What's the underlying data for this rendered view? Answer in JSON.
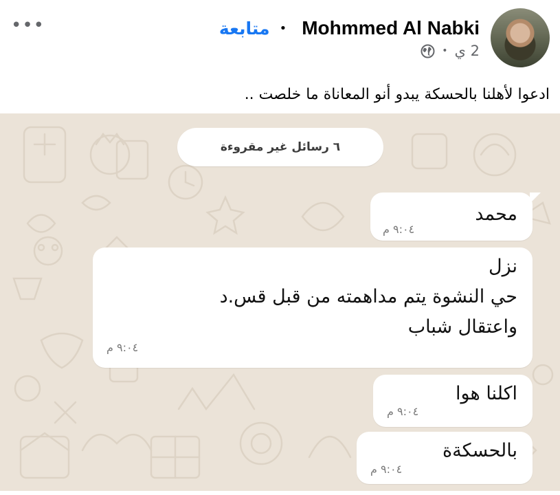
{
  "post": {
    "author_name": "Mohmmed Al Nabki",
    "follow_label": "متابعة",
    "separator": "•",
    "time": "2 ي",
    "meta_separator": "•",
    "privacy_icon": "globe-icon",
    "more_label": "•••",
    "caption": "ادعوا لأهلنا بالحسكة يبدو أنو المعاناة ما خلصت .."
  },
  "chat": {
    "unread_label": "٦ رسائل غير مقروءة",
    "messages": [
      {
        "text": "محمد",
        "time": "٩:٠٤ م"
      },
      {
        "text": "نزل\nحي النشوة يتم مداهمته من قبل قس.د\nواعتقال شباب",
        "time": "٩:٠٤ م"
      },
      {
        "text": "اكلنا هوا",
        "time": "٩:٠٤ م"
      },
      {
        "text": "بالحسكةة",
        "time": "٩:٠٤ م"
      }
    ]
  },
  "colors": {
    "brand": "#1877f2",
    "chat_background": "#ebe3d8",
    "bubble": "#ffffff",
    "muted_text": "#65676b"
  }
}
